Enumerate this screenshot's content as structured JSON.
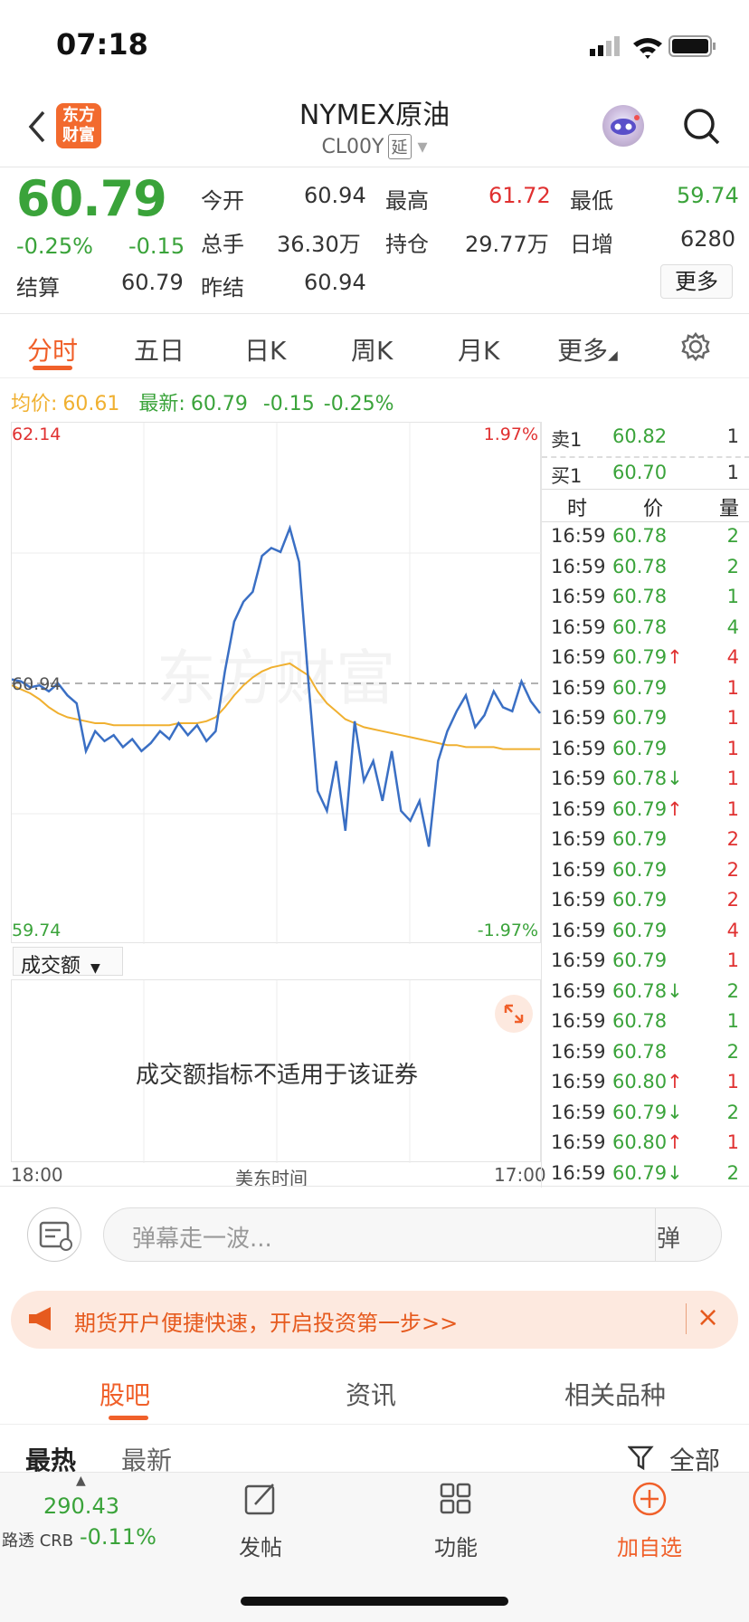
{
  "status_bar": {
    "time": "07:18"
  },
  "header": {
    "title": "NYMEX原油",
    "code": "CL00Y",
    "delay_tag": "延",
    "logo_text": "东方财富"
  },
  "quote": {
    "last": "60.79",
    "pct": "-0.25%",
    "change": "-0.15",
    "open_label": "今开",
    "open": "60.94",
    "high_label": "最高",
    "high": "61.72",
    "low_label": "最低",
    "low": "59.74",
    "volume_label": "总手",
    "volume": "36.30万",
    "oi_label": "持仓",
    "oi": "29.77万",
    "daily_inc_label": "日增",
    "daily_inc": "6280",
    "settle_label": "结算",
    "settle": "60.79",
    "prev_settle_label": "昨结",
    "prev_settle": "60.94",
    "more_label": "更多"
  },
  "chart_tabs": [
    "分时",
    "五日",
    "日K",
    "周K",
    "月K",
    "更多"
  ],
  "avg_line": {
    "avg_label": "均价:",
    "avg": "60.61",
    "latest_label": "最新:",
    "latest": "60.79",
    "change": "-0.15",
    "pct": "-0.25%"
  },
  "chart_data": {
    "type": "line",
    "ylim": [
      59.74,
      62.14
    ],
    "y_top_label": "62.14",
    "y_bottom_label": "59.74",
    "pct_top_label": "1.97%",
    "pct_bottom_label": "-1.97%",
    "ref_label": "60.94",
    "ref_value": 60.94,
    "x_start": "18:00",
    "x_mid": "美东时间",
    "x_end": "17:00",
    "watermark": "东方财富",
    "series": [
      {
        "values": [
          60.96,
          60.95,
          60.92,
          60.93,
          60.9,
          60.94,
          60.88,
          60.84,
          60.6,
          60.7,
          60.65,
          60.68,
          60.62,
          60.66,
          60.6,
          60.64,
          60.7,
          60.66,
          60.74,
          60.68,
          60.73,
          60.65,
          60.7,
          61.0,
          61.25,
          61.35,
          61.4,
          61.58,
          61.62,
          61.6,
          61.72,
          61.55,
          60.95,
          60.4,
          60.3,
          60.55,
          60.2,
          60.75,
          60.45,
          60.55,
          60.35,
          60.6,
          60.3,
          60.25,
          60.35,
          60.12,
          60.55,
          60.7,
          60.8,
          60.88,
          60.72,
          60.78,
          60.9,
          60.82,
          60.8,
          60.95,
          60.85,
          60.79
        ]
      },
      {
        "values": [
          60.93,
          60.91,
          60.89,
          60.86,
          60.82,
          60.79,
          60.77,
          60.76,
          60.75,
          60.74,
          60.74,
          60.73,
          60.73,
          60.73,
          60.73,
          60.73,
          60.73,
          60.73,
          60.74,
          60.74,
          60.74,
          60.75,
          60.77,
          60.82,
          60.88,
          60.93,
          60.97,
          61.0,
          61.02,
          61.03,
          61.04,
          61.01,
          60.98,
          60.9,
          60.84,
          60.8,
          60.76,
          60.74,
          60.72,
          60.71,
          60.7,
          60.69,
          60.68,
          60.67,
          60.66,
          60.65,
          60.64,
          60.63,
          60.63,
          60.62,
          60.62,
          60.62,
          60.62,
          60.61,
          60.61,
          60.61,
          60.61,
          60.61
        ]
      }
    ]
  },
  "order_book": {
    "ask_label": "卖1",
    "ask_price": "60.82",
    "ask_vol": "1",
    "bid_label": "买1",
    "bid_price": "60.70",
    "bid_vol": "1",
    "col_time": "时",
    "col_price": "价",
    "col_vol": "量",
    "ticks": [
      {
        "t": "16:59",
        "p": "60.78",
        "a": "",
        "v": "2",
        "c": "green"
      },
      {
        "t": "16:59",
        "p": "60.78",
        "a": "",
        "v": "2",
        "c": "green"
      },
      {
        "t": "16:59",
        "p": "60.78",
        "a": "",
        "v": "1",
        "c": "green"
      },
      {
        "t": "16:59",
        "p": "60.78",
        "a": "",
        "v": "4",
        "c": "green"
      },
      {
        "t": "16:59",
        "p": "60.79",
        "a": "↑",
        "v": "4",
        "c": "red"
      },
      {
        "t": "16:59",
        "p": "60.79",
        "a": "",
        "v": "1",
        "c": "red"
      },
      {
        "t": "16:59",
        "p": "60.79",
        "a": "",
        "v": "1",
        "c": "red"
      },
      {
        "t": "16:59",
        "p": "60.79",
        "a": "",
        "v": "1",
        "c": "red"
      },
      {
        "t": "16:59",
        "p": "60.78",
        "a": "↓",
        "v": "1",
        "c": "red"
      },
      {
        "t": "16:59",
        "p": "60.79",
        "a": "↑",
        "v": "1",
        "c": "red"
      },
      {
        "t": "16:59",
        "p": "60.79",
        "a": "",
        "v": "2",
        "c": "red"
      },
      {
        "t": "16:59",
        "p": "60.79",
        "a": "",
        "v": "2",
        "c": "red"
      },
      {
        "t": "16:59",
        "p": "60.79",
        "a": "",
        "v": "2",
        "c": "red"
      },
      {
        "t": "16:59",
        "p": "60.79",
        "a": "",
        "v": "4",
        "c": "red"
      },
      {
        "t": "16:59",
        "p": "60.79",
        "a": "",
        "v": "1",
        "c": "red"
      },
      {
        "t": "16:59",
        "p": "60.78",
        "a": "↓",
        "v": "2",
        "c": "green"
      },
      {
        "t": "16:59",
        "p": "60.78",
        "a": "",
        "v": "1",
        "c": "green"
      },
      {
        "t": "16:59",
        "p": "60.78",
        "a": "",
        "v": "2",
        "c": "green"
      },
      {
        "t": "16:59",
        "p": "60.80",
        "a": "↑",
        "v": "1",
        "c": "red"
      },
      {
        "t": "16:59",
        "p": "60.79",
        "a": "↓",
        "v": "2",
        "c": "green"
      },
      {
        "t": "16:59",
        "p": "60.80",
        "a": "↑",
        "v": "1",
        "c": "red"
      },
      {
        "t": "16:59",
        "p": "60.79",
        "a": "↓",
        "v": "2",
        "c": "green"
      }
    ]
  },
  "volume_panel": {
    "selector": "成交额",
    "message": "成交额指标不适用于该证券"
  },
  "danmu": {
    "placeholder": "弹幕走一波...",
    "button": "弹"
  },
  "banner": {
    "text": "期货开户便捷快速，开启投资第一步>>"
  },
  "bottom_tabs": [
    "股吧",
    "资讯",
    "相关品种"
  ],
  "sort": {
    "hot": "最热",
    "latest": "最新",
    "all": "全部"
  },
  "bottom_bar": {
    "index_value": "290.43",
    "index_name": "路透 CRB",
    "index_pct": "-0.11%",
    "post": "发帖",
    "func": "功能",
    "add": "加自选"
  },
  "colors": {
    "accent": "#f0602a",
    "up": "#e03030",
    "down": "#3aa33a",
    "price_line": "#3a6fc4",
    "avg_line": "#f0b030"
  }
}
